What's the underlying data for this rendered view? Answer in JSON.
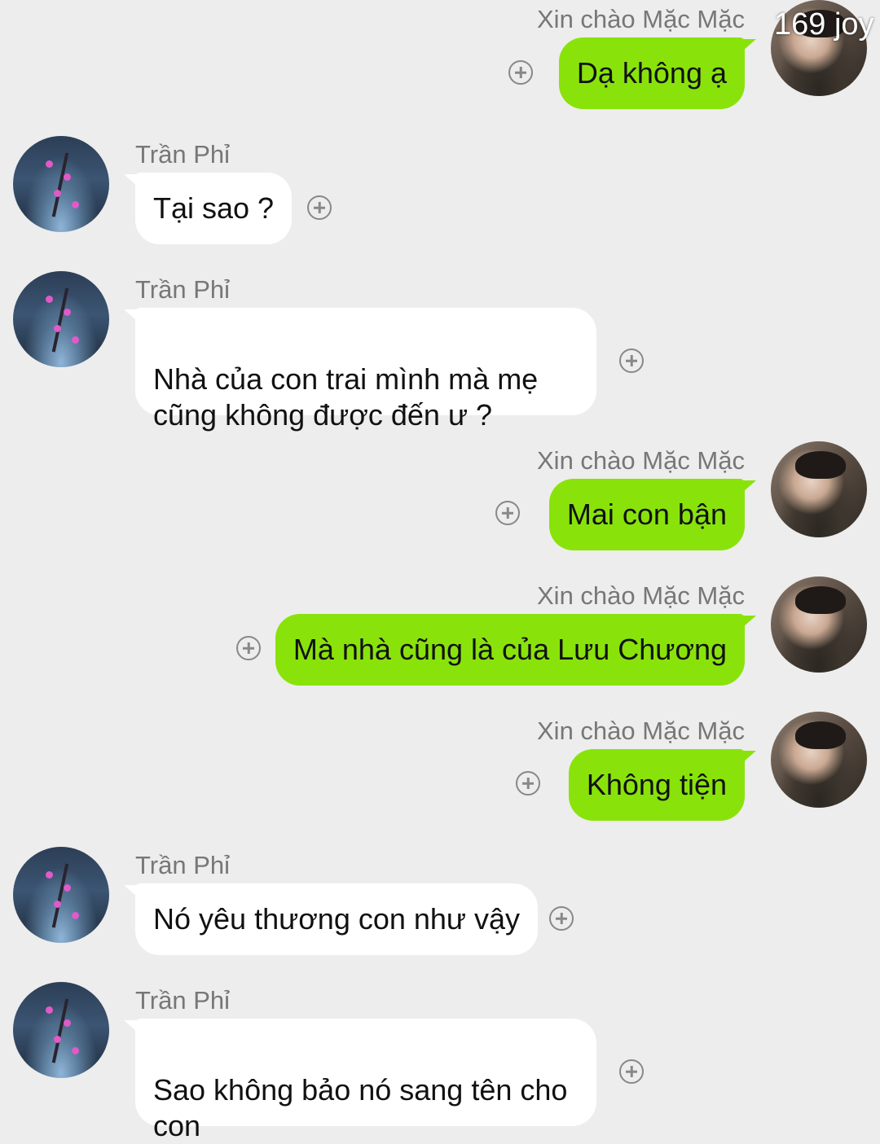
{
  "watermark": "169 joy",
  "colors": {
    "background": "#ededed",
    "outgoing_bubble": "#89e30b",
    "incoming_bubble": "#ffffff",
    "name_text": "#777777",
    "plus_icon": "#888888"
  },
  "messages": [
    {
      "sender": "Xin chào Mặc Mặc",
      "text": "Dạ không ạ",
      "side": "right"
    },
    {
      "sender": "Trần Phỉ",
      "text": "Tại sao ?",
      "side": "left"
    },
    {
      "sender": "Trần Phỉ",
      "text": "Nhà của con trai mình mà mẹ\ncũng không được đến ư ?",
      "side": "left"
    },
    {
      "sender": "Xin chào Mặc Mặc",
      "text": "Mai con bận",
      "side": "right"
    },
    {
      "sender": "Xin chào Mặc Mặc",
      "text": "Mà nhà cũng là của Lưu Chương",
      "side": "right"
    },
    {
      "sender": "Xin chào Mặc Mặc",
      "text": "Không tiện",
      "side": "right"
    },
    {
      "sender": "Trần Phỉ",
      "text": "Nó yêu thương con như vậy",
      "side": "left"
    },
    {
      "sender": "Trần Phỉ",
      "text": "Sao không bảo nó sang tên cho\ncon",
      "side": "left"
    }
  ],
  "icons": {
    "add_reaction": "plus-circle-icon",
    "avatar_left": "plum-blossom-avatar",
    "avatar_right": "profile-photo-avatar"
  }
}
